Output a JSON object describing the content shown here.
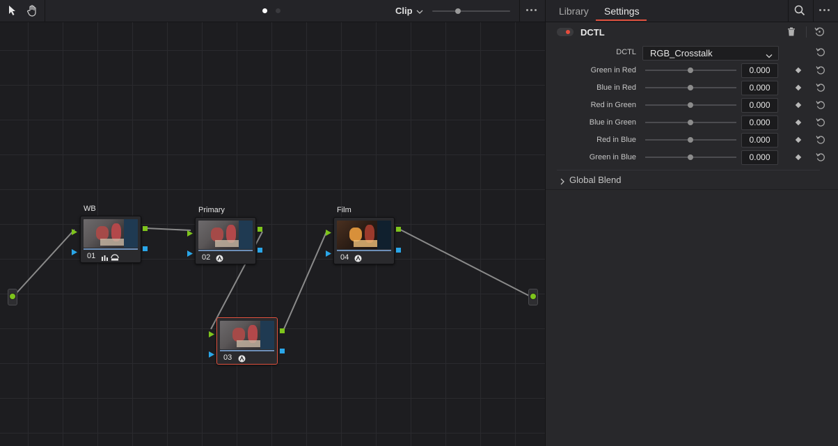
{
  "editor": {
    "toolbar": {
      "pointer_tool": "pointer-icon",
      "hand_tool": "hand-icon",
      "mode_label": "Clip",
      "more": "more-icon"
    },
    "nodes": [
      {
        "id": "01",
        "label": "WB",
        "number": "01",
        "selected": false,
        "icons": [
          "bars-icon",
          "hdr-icon"
        ]
      },
      {
        "id": "02",
        "label": "Primary",
        "number": "02",
        "selected": false,
        "icons": [
          "fx-icon"
        ]
      },
      {
        "id": "03",
        "label": "",
        "number": "03",
        "selected": true,
        "icons": [
          "fx-icon"
        ]
      },
      {
        "id": "04",
        "label": "Film",
        "number": "04",
        "selected": false,
        "icons": [
          "fx-icon"
        ]
      }
    ]
  },
  "panel": {
    "tabs": [
      {
        "label": "Library",
        "active": false
      },
      {
        "label": "Settings",
        "active": true
      }
    ],
    "accent_color": "#e0513e",
    "dctl": {
      "title": "DCTL",
      "enabled": true,
      "select_label": "DCTL",
      "select_value": "RGB_Crosstalk",
      "params": [
        {
          "label": "Green in Red",
          "value": "0.000"
        },
        {
          "label": "Blue in Red",
          "value": "0.000"
        },
        {
          "label": "Red in Green",
          "value": "0.000"
        },
        {
          "label": "Blue in Green",
          "value": "0.000"
        },
        {
          "label": "Red in Blue",
          "value": "0.000"
        },
        {
          "label": "Green in Blue",
          "value": "0.000"
        }
      ]
    },
    "global_blend": {
      "label": "Global Blend",
      "expanded": false
    }
  }
}
